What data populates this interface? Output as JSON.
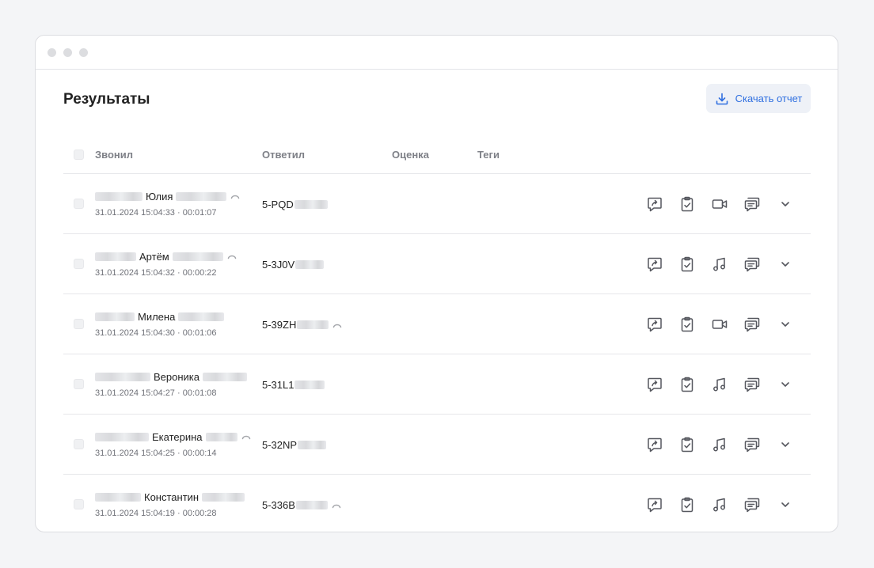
{
  "window": {
    "traffic_lights": [
      "close",
      "minimize",
      "zoom"
    ]
  },
  "page": {
    "title": "Результаты"
  },
  "toolbar": {
    "download_label": "Скачать отчет",
    "download_icon": "download-icon"
  },
  "table": {
    "columns": [
      "Звонил",
      "Ответил",
      "Оценка",
      "Теги"
    ],
    "rows": [
      {
        "caller_name": "Юлия",
        "datetime": "31.01.2024 15:04:33 · 00:01:07",
        "answered": "5-PQD",
        "caller_redirect": true,
        "answered_redirect": false,
        "media": "video"
      },
      {
        "caller_name": "Артём",
        "datetime": "31.01.2024 15:04:32 · 00:00:22",
        "answered": "5-3J0V",
        "caller_redirect": true,
        "answered_redirect": false,
        "media": "audio"
      },
      {
        "caller_name": "Милена",
        "datetime": "31.01.2024 15:04:30 · 00:01:06",
        "answered": "5-39ZH",
        "caller_redirect": false,
        "answered_redirect": true,
        "media": "video"
      },
      {
        "caller_name": "Вероника",
        "datetime": "31.01.2024 15:04:27 · 00:01:08",
        "answered": "5-31L1",
        "caller_redirect": false,
        "answered_redirect": false,
        "media": "audio"
      },
      {
        "caller_name": "Екатерина",
        "datetime": "31.01.2024 15:04:25 · 00:00:14",
        "answered": "5-32NP",
        "caller_redirect": true,
        "answered_redirect": false,
        "media": "audio"
      },
      {
        "caller_name": "Константин",
        "datetime": "31.01.2024 15:04:19 · 00:00:28",
        "answered": "5-336B",
        "caller_redirect": false,
        "answered_redirect": true,
        "media": "audio"
      }
    ]
  },
  "row_actions": [
    "share-icon",
    "clipboard-check-icon",
    "media-icon",
    "chat-icon",
    "chevron-down-icon"
  ],
  "colors": {
    "accent": "#2f6fe0",
    "icon": "#55575e",
    "muted": "#7e8087"
  }
}
